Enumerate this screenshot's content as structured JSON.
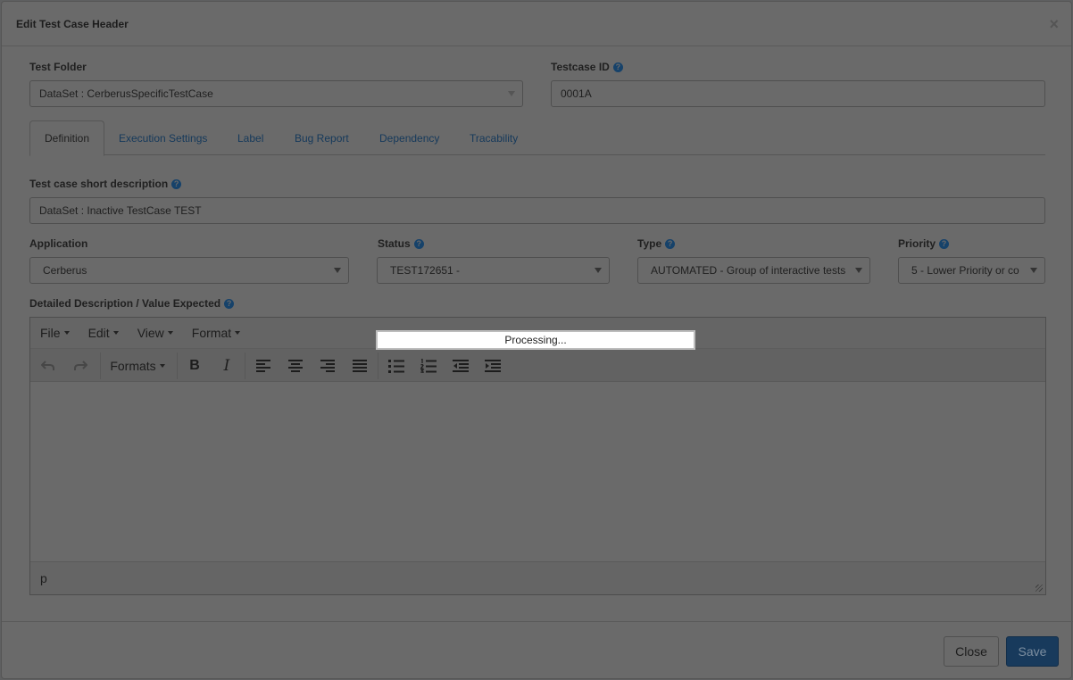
{
  "modal": {
    "title": "Edit Test Case Header",
    "close_glyph": "×"
  },
  "form": {
    "test_folder": {
      "label": "Test Folder",
      "value": "DataSet : CerberusSpecificTestCase"
    },
    "testcase_id": {
      "label": "Testcase ID",
      "value": "0001A"
    },
    "short_description": {
      "label": "Test case short description",
      "value": "DataSet : Inactive TestCase TEST"
    },
    "application": {
      "label": "Application",
      "value": "Cerberus"
    },
    "status": {
      "label": "Status",
      "value": "TEST172651 -"
    },
    "type": {
      "label": "Type",
      "value": "AUTOMATED - Group of interactive tests"
    },
    "priority": {
      "label": "Priority",
      "value": "5 - Lower Priority or co"
    },
    "detailed_description": {
      "label": "Detailed Description / Value Expected"
    }
  },
  "tabs": [
    {
      "label": "Definition",
      "active": true
    },
    {
      "label": "Execution Settings",
      "active": false
    },
    {
      "label": "Label",
      "active": false
    },
    {
      "label": "Bug Report",
      "active": false
    },
    {
      "label": "Dependency",
      "active": false
    },
    {
      "label": "Tracability",
      "active": false
    }
  ],
  "editor": {
    "menus": [
      "File",
      "Edit",
      "View",
      "Format"
    ],
    "formats_label": "Formats",
    "status_path": "p",
    "toolbar_icons": [
      "undo-icon",
      "redo-icon",
      "bold-icon",
      "italic-icon",
      "align-left-icon",
      "align-center-icon",
      "align-right-icon",
      "align-justify-icon",
      "bullet-list-icon",
      "numbered-list-icon",
      "outdent-icon",
      "indent-icon"
    ]
  },
  "processing": {
    "text": "Processing..."
  },
  "footer": {
    "close_label": "Close",
    "save_label": "Save"
  },
  "colors": {
    "overlay": "#5f6061",
    "link": "#15395b",
    "primary_button": "#183a5c",
    "help_icon": "#16426a"
  }
}
